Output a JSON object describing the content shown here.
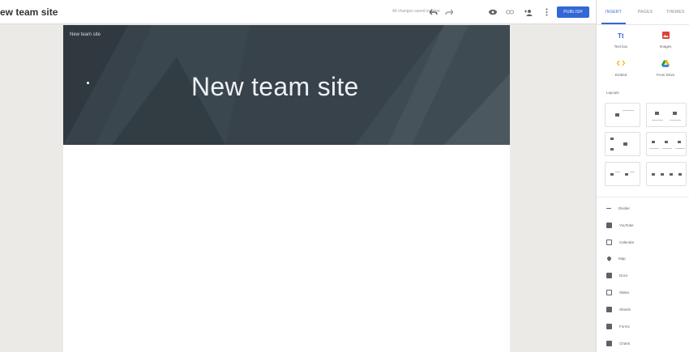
{
  "topbar": {
    "site_title": "ew team site",
    "status": "All changes saved in Drive",
    "publish_label": "PUBLISH",
    "icons": [
      "undo-icon",
      "redo-icon",
      "preview-icon",
      "link-icon",
      "add-person-icon",
      "more-vert-icon"
    ]
  },
  "canvas": {
    "header_small_title": "New team site",
    "header_title": "New team site",
    "header_bg": "#37424a"
  },
  "panel": {
    "tabs": [
      {
        "label": "INSERT",
        "active": true
      },
      {
        "label": "PAGES",
        "active": false
      },
      {
        "label": "THEMES",
        "active": false
      }
    ],
    "insert_items": [
      {
        "label": "Text box",
        "icon": "text-box-icon"
      },
      {
        "label": "Images",
        "icon": "images-icon"
      },
      {
        "label": "Embed",
        "icon": "embed-icon"
      },
      {
        "label": "From Drive",
        "icon": "drive-icon"
      }
    ],
    "layouts_label": "Layouts",
    "components": [
      {
        "label": "Divider",
        "icon": "divider-icon"
      },
      {
        "label": "YouTube",
        "icon": "youtube-icon"
      },
      {
        "label": "Calendar",
        "icon": "calendar-icon"
      },
      {
        "label": "Map",
        "icon": "map-icon"
      },
      {
        "label": "Docs",
        "icon": "docs-icon"
      },
      {
        "label": "Slides",
        "icon": "slides-icon"
      },
      {
        "label": "Sheets",
        "icon": "sheets-icon"
      },
      {
        "label": "Forms",
        "icon": "forms-icon"
      },
      {
        "label": "Charts",
        "icon": "charts-icon"
      }
    ],
    "accent": "#3367d6"
  }
}
